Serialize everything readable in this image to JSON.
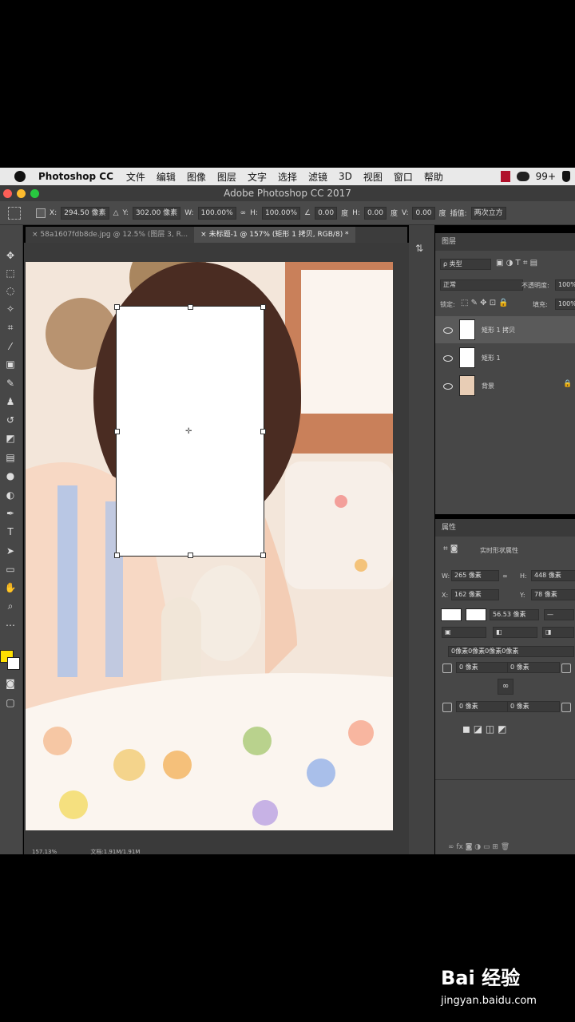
{
  "menubar": {
    "app": "Photoshop CC",
    "items": [
      "文件",
      "编辑",
      "图像",
      "图层",
      "文字",
      "选择",
      "滤镜",
      "3D",
      "视图",
      "窗口",
      "帮助"
    ],
    "badge": "99+"
  },
  "window": {
    "title": "Adobe Photoshop CC 2017"
  },
  "options": {
    "x_label": "X:",
    "x_value": "294.50 像素",
    "y_label": "Y:",
    "y_value": "302.00 像素",
    "w_label": "W:",
    "w_value": "100.00%",
    "h_label": "H:",
    "h_value": "100.00%",
    "angle_value": "0.00",
    "angle_unit": "度",
    "hskew_label": "H:",
    "hskew_value": "0.00",
    "hskew_unit": "度",
    "vskew_label": "V:",
    "vskew_value": "0.00",
    "vskew_unit": "度",
    "interp_label": "插值:",
    "interp_value": "两次立方"
  },
  "tabs": [
    {
      "label": "58a1607fdb8de.jpg @ 12.5% (图层 3, R..."
    },
    {
      "label": "未标题-1 @ 157% (矩形 1 拷贝, RGB/8) *"
    }
  ],
  "status": {
    "zoom": "157.13%",
    "doc": "文档:1.91M/1.91M"
  },
  "layers_panel": {
    "title": "图层",
    "filter": "ρ 类型",
    "blend": "正常",
    "opacity_label": "不透明度:",
    "opacity_value": "100%",
    "lock_label": "锁定:",
    "fill_label": "填充:",
    "fill_value": "100%",
    "layers": [
      {
        "name": "矩形 1 拷贝"
      },
      {
        "name": "矩形 1"
      },
      {
        "name": "背景"
      }
    ]
  },
  "properties_panel": {
    "title": "属性",
    "subtitle": "实时形状属性",
    "w_label": "W:",
    "w_value": "265 像素",
    "h_label": "H:",
    "h_value": "448 像素",
    "x_label": "X:",
    "x_value": "162 像素",
    "y_label": "Y:",
    "y_value": "78 像素",
    "stroke_width": "56.53 像素",
    "corners_all": "0像素0像素0像素0像素",
    "corner_tl": "0 像素",
    "corner_tr": "0 像素",
    "corner_bl": "0 像素",
    "corner_br": "0 像素"
  },
  "watermark": {
    "brand": "Bai 经验",
    "url": "jingyan.baidu.com"
  },
  "colors": {
    "foreground": "#ffe000",
    "background": "#ffffff",
    "accent": "#5a5a5a"
  }
}
